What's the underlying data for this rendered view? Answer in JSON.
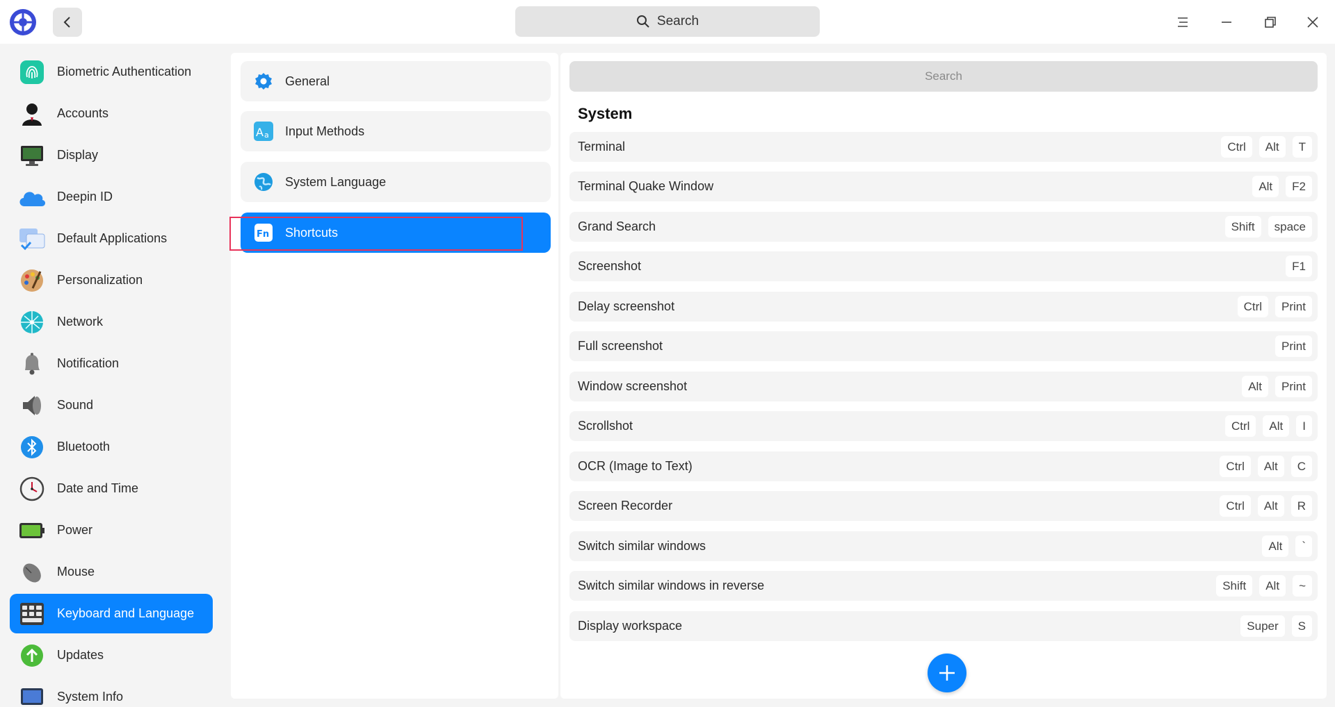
{
  "titlebar": {
    "search_label": "Search"
  },
  "sidebar": {
    "items": [
      {
        "label": "Biometric Authentication",
        "icon": "fingerprint-icon"
      },
      {
        "label": "Accounts",
        "icon": "user-icon"
      },
      {
        "label": "Display",
        "icon": "monitor-icon"
      },
      {
        "label": "Deepin ID",
        "icon": "cloud-icon"
      },
      {
        "label": "Default Applications",
        "icon": "default-apps-icon"
      },
      {
        "label": "Personalization",
        "icon": "palette-icon"
      },
      {
        "label": "Network",
        "icon": "network-icon"
      },
      {
        "label": "Notification",
        "icon": "bell-icon"
      },
      {
        "label": "Sound",
        "icon": "speaker-icon"
      },
      {
        "label": "Bluetooth",
        "icon": "bluetooth-icon"
      },
      {
        "label": "Date and Time",
        "icon": "clock-icon"
      },
      {
        "label": "Power",
        "icon": "battery-icon"
      },
      {
        "label": "Mouse",
        "icon": "mouse-icon"
      },
      {
        "label": "Keyboard and Language",
        "icon": "keyboard-icon",
        "active": true
      },
      {
        "label": "Updates",
        "icon": "update-arrow-icon"
      },
      {
        "label": "System Info",
        "icon": "system-info-icon"
      }
    ]
  },
  "middle": {
    "items": [
      {
        "label": "General",
        "icon": "gear-icon"
      },
      {
        "label": "Input Methods",
        "icon": "input-methods-icon"
      },
      {
        "label": "System Language",
        "icon": "globe-icon"
      },
      {
        "label": "Shortcuts",
        "icon": "fn-key-icon",
        "active": true
      }
    ]
  },
  "right": {
    "search_placeholder": "Search",
    "section_title": "System",
    "shortcuts": [
      {
        "name": "Terminal",
        "keys": [
          "Ctrl",
          "Alt",
          "T"
        ]
      },
      {
        "name": "Terminal Quake Window",
        "keys": [
          "Alt",
          "F2"
        ]
      },
      {
        "name": "Grand Search",
        "keys": [
          "Shift",
          "space"
        ]
      },
      {
        "name": "Screenshot",
        "keys": [
          "F1"
        ]
      },
      {
        "name": "Delay screenshot",
        "keys": [
          "Ctrl",
          "Print"
        ]
      },
      {
        "name": "Full screenshot",
        "keys": [
          "Print"
        ]
      },
      {
        "name": "Window screenshot",
        "keys": [
          "Alt",
          "Print"
        ]
      },
      {
        "name": "Scrollshot",
        "keys": [
          "Ctrl",
          "Alt",
          "I"
        ]
      },
      {
        "name": "OCR (Image to Text)",
        "keys": [
          "Ctrl",
          "Alt",
          "C"
        ]
      },
      {
        "name": "Screen Recorder",
        "keys": [
          "Ctrl",
          "Alt",
          "R"
        ]
      },
      {
        "name": "Switch similar windows",
        "keys": [
          "Alt",
          "`"
        ]
      },
      {
        "name": "Switch similar windows in reverse",
        "keys": [
          "Shift",
          "Alt",
          "~"
        ]
      },
      {
        "name": "Display workspace",
        "keys": [
          "Super",
          "S"
        ]
      }
    ]
  },
  "colors": {
    "accent": "#0a84ff",
    "highlight_border": "#e8335a"
  }
}
